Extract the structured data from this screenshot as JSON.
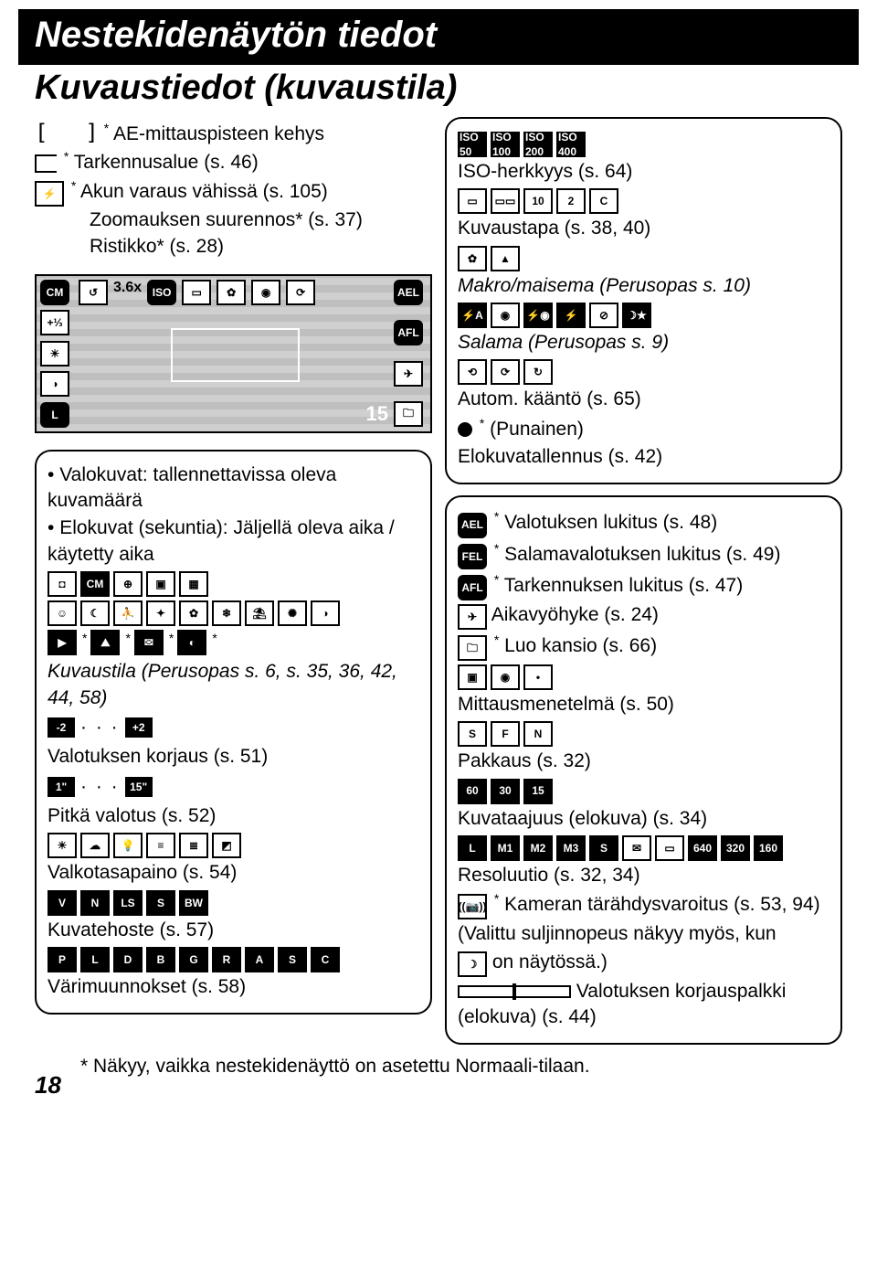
{
  "page_number": "18",
  "title": "Nestekidenäytön tiedot",
  "subtitle": "Kuvaustiedot (kuvaustila)",
  "footnote": "* Näkyy, vaikka nestekidenäyttö on asetettu Normaali-tilaan.",
  "lcd": {
    "zoom": "3.6x",
    "shots": "15"
  },
  "left_callouts": {
    "ae_frame": "AE-mittauspisteen kehys",
    "focus_area": "Tarkennusalue (s. 46)",
    "battery": "Akun varaus vähissä (s. 105)",
    "zoom": "Zoomauksen suurennos* (s. 37)",
    "grid": "Ristikko* (s. 28)"
  },
  "left_box": {
    "bullet1": "Valokuvat: tallennettavissa oleva kuvamäärä",
    "bullet2": "Elokuvat (sekuntia): Jäljellä oleva aika / käytetty aika",
    "shooting_mode": "Kuvaustila (Perusopas s. 6, s. 35, 36, 42, 44, 58)",
    "ev_comp": "Valotuksen korjaus (s. 51)",
    "long_exp": "Pitkä valotus (s. 52)",
    "wb": "Valkotasapaino (s. 54)",
    "effect": "Kuvatehoste (s. 57)",
    "color_conv": "Värimuunnokset (s. 58)"
  },
  "right_box_top": {
    "iso": "ISO-herkkyys (s. 64)",
    "drive": "Kuvaustapa (s. 38, 40)",
    "macro": "Makro/maisema (Perusopas s. 10)",
    "flash": "Salama (Perusopas s. 9)",
    "rotate": "Autom. kääntö (s. 65)",
    "red_dot": "(Punainen)",
    "movie_rec": "Elokuvatallennus (s. 42)"
  },
  "right_box_bottom": {
    "ae_lock": "Valotuksen lukitus (s. 48)",
    "fe_lock": "Salamavalotuksen lukitus (s. 49)",
    "af_lock": "Tarkennuksen lukitus (s. 47)",
    "timezone": "Aikavyöhyke (s. 24)",
    "create_folder": "Luo kansio (s. 66)",
    "metering": "Mittausmenetelmä (s. 50)",
    "compress": "Pakkaus (s. 32)",
    "framerate": "Kuvataajuus (elokuva) (s. 34)",
    "resolution": "Resoluutio (s. 32, 34)",
    "shake_warn": "Kameran tärähdysvaroitus (s. 53, 94)",
    "shake_note": "(Valittu suljinnopeus näkyy myös, kun",
    "shake_note2": "on näytössä.)",
    "exp_bar": "Valotuksen korjauspalkki (elokuva) (s. 44)"
  },
  "icon_labels": {
    "ael": "AEL",
    "afl": "AFL",
    "fel": "FEL",
    "iso50": "ISO 50",
    "iso100": "ISO 100",
    "iso200": "ISO 200",
    "iso400": "ISO 400",
    "cm": "CM",
    "l": "L",
    "m1": "M1",
    "m2": "M2",
    "m3": "M3",
    "s": "S",
    "s_comp": "S",
    "fine": "F",
    "norm": "N",
    "t1": "1\"",
    "t15": "15\"",
    "minus2": "-2",
    "plus2": "+2",
    "r60": "60",
    "r30": "30",
    "r15": "15",
    "r640": "640",
    "r320": "320",
    "r160": "160",
    "c10": "10",
    "c2": "2",
    "cc": "C"
  }
}
